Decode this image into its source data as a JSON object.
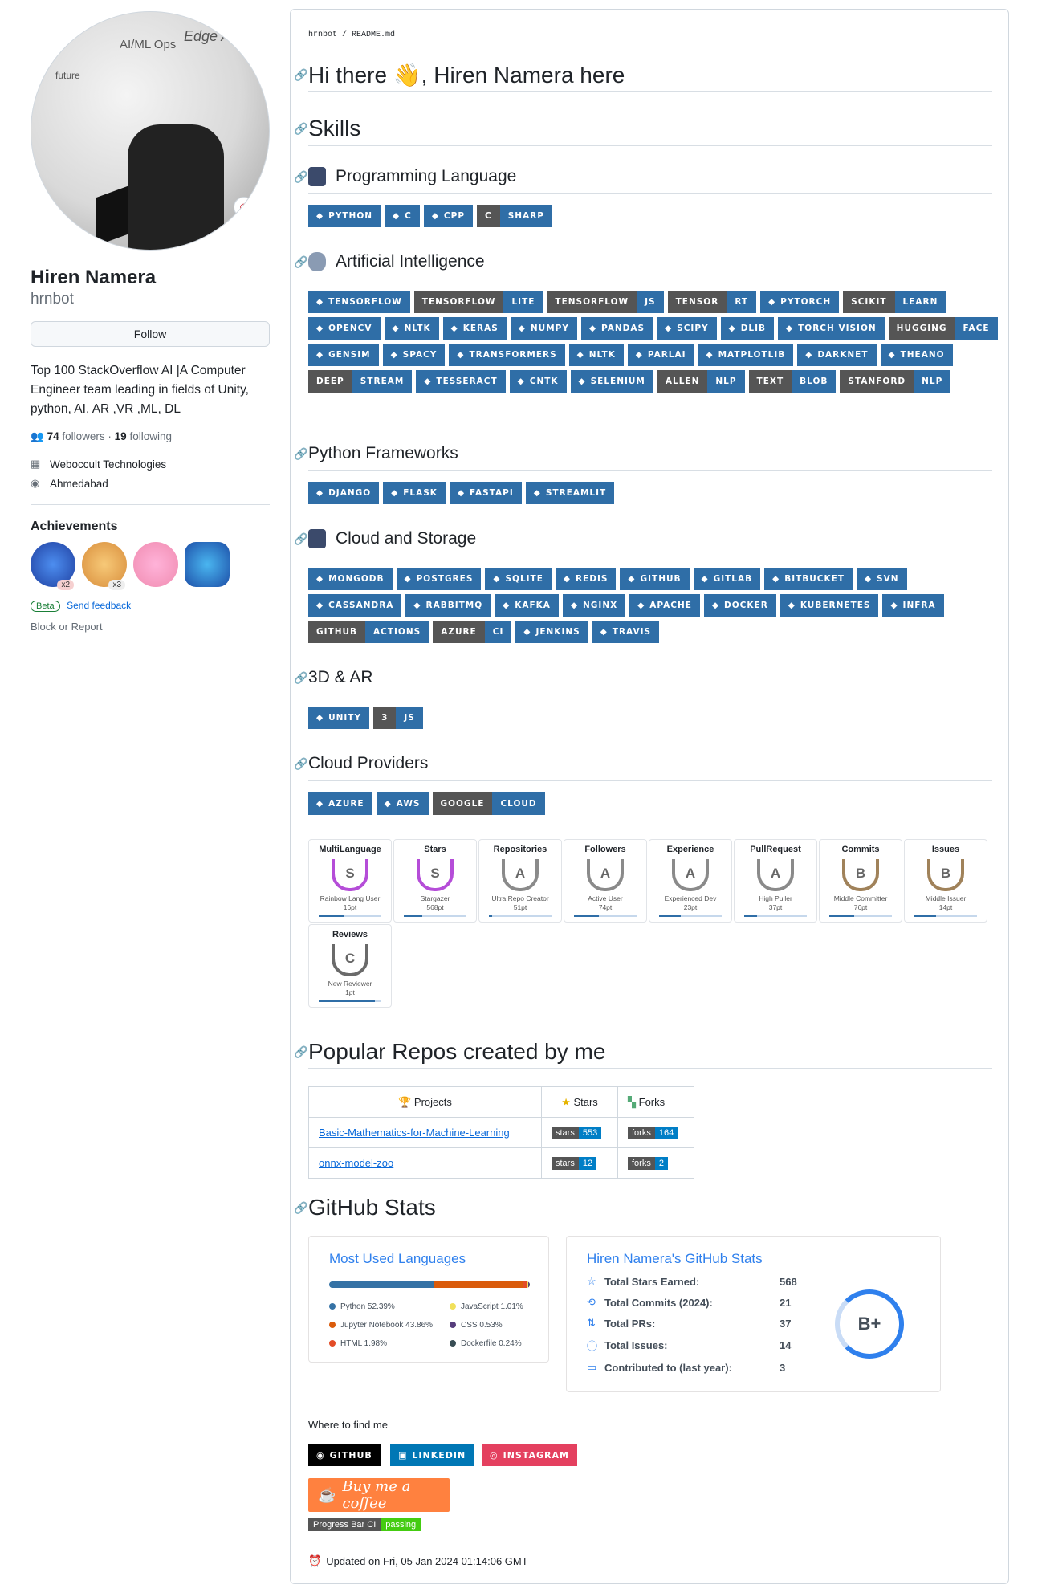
{
  "profile": {
    "name": "Hiren Namera",
    "login": "hrnbot",
    "follow": "Follow",
    "bio": "Top 100 StackOverflow AI |A Computer Engineer team leading in fields of Unity, python, AI, AR ,VR ,ML, DL",
    "followers_count": "74",
    "followers_label": "followers",
    "following_count": "19",
    "following_label": "following",
    "company": "Weboccult Technologies",
    "location": "Ahmedabad",
    "achievements_title": "Achievements",
    "ach_x2": "x2",
    "ach_x3": "x3",
    "beta": "Beta",
    "send_feedback": "Send feedback",
    "block": "Block or Report",
    "wall_texts": [
      "AI/ML Ops",
      "Edge AI",
      "e",
      "future"
    ]
  },
  "readme": {
    "crumb": "hrnbot / README.md",
    "h_hi": "Hi there 👋, Hiren Namera here",
    "h_skills": "Skills",
    "h_prog": "Programming Language",
    "h_ai": "Artificial Intelligence",
    "h_pyfw": "Python Frameworks",
    "h_cloud": "Cloud and Storage",
    "h_3d": "3D & AR",
    "h_providers": "Cloud Providers",
    "h_repos": "Popular Repos created by me",
    "h_stats": "GitHub Stats",
    "where": "Where to find me",
    "updated": "Updated on Fri, 05 Jan 2024 01:14:06 GMT"
  },
  "badges": {
    "prog": [
      [
        "",
        "PYTHON"
      ],
      [
        "",
        "C"
      ],
      [
        "",
        "CPP"
      ],
      [
        "C",
        "SHARP"
      ]
    ],
    "ai": [
      [
        "",
        "TENSORFLOW"
      ],
      [
        "TENSORFLOW",
        "LITE"
      ],
      [
        "TENSORFLOW",
        "JS"
      ],
      [
        "TENSOR",
        "RT"
      ],
      [
        "",
        "PYTORCH"
      ],
      [
        "SCIKIT",
        "LEARN"
      ],
      [
        "",
        "OPENCV"
      ],
      [
        "",
        "NLTK"
      ],
      [
        "",
        "KERAS"
      ],
      [
        "",
        "NUMPY"
      ],
      [
        "",
        "PANDAS"
      ],
      [
        "",
        "SCIPY"
      ],
      [
        "",
        "DLIB"
      ],
      [
        "",
        "TORCH VISION"
      ],
      [
        "HUGGING",
        "FACE"
      ],
      [
        "",
        "GENSIM"
      ],
      [
        "",
        "SPACY"
      ],
      [
        "",
        "TRANSFORMERS"
      ],
      [
        "",
        "NLTK"
      ],
      [
        "",
        "PARLAI"
      ],
      [
        "",
        "MATPLOTLIB"
      ],
      [
        "",
        "DARKNET"
      ],
      [
        "",
        "THEANO"
      ],
      [
        "DEEP",
        "STREAM"
      ],
      [
        "",
        "TESSERACT"
      ],
      [
        "",
        "CNTK"
      ],
      [
        "",
        "SELENIUM"
      ],
      [
        "ALLEN",
        "NLP"
      ],
      [
        "TEXT",
        "BLOB"
      ],
      [
        "STANFORD",
        "NLP"
      ]
    ],
    "pyfw": [
      [
        "",
        "DJANGO"
      ],
      [
        "",
        "FLASK"
      ],
      [
        "",
        "FASTAPI"
      ],
      [
        "",
        "STREAMLIT"
      ]
    ],
    "cloud": [
      [
        "",
        "MONGODB"
      ],
      [
        "",
        "POSTGRES"
      ],
      [
        "",
        "SQLITE"
      ],
      [
        "",
        "REDIS"
      ],
      [
        "",
        "GITHUB"
      ],
      [
        "",
        "GITLAB"
      ],
      [
        "",
        "BITBUCKET"
      ],
      [
        "",
        "SVN"
      ],
      [
        "",
        "CASSANDRA"
      ],
      [
        "",
        "RABBITMQ"
      ],
      [
        "",
        "KAFKA"
      ],
      [
        "",
        "NGINX"
      ],
      [
        "",
        "APACHE"
      ],
      [
        "",
        "DOCKER"
      ],
      [
        "",
        "KUBERNETES"
      ],
      [
        "",
        "INFRA"
      ],
      [
        "GITHUB",
        "ACTIONS"
      ],
      [
        "AZURE",
        "CI"
      ],
      [
        "",
        "JENKINS"
      ],
      [
        "",
        "TRAVIS"
      ]
    ],
    "ar": [
      [
        "",
        "UNITY"
      ],
      [
        "3",
        "JS"
      ]
    ],
    "providers": [
      [
        "",
        "AZURE"
      ],
      [
        "",
        "AWS"
      ],
      [
        "GOOGLE",
        "CLOUD"
      ]
    ]
  },
  "trophies": [
    {
      "title": "MultiLanguage",
      "rank": "S",
      "sub": "Rainbow Lang User",
      "pts": "16pt",
      "progress": 0.4
    },
    {
      "title": "Stars",
      "rank": "S",
      "sub": "Stargazer",
      "pts": "568pt",
      "progress": 0.3
    },
    {
      "title": "Repositories",
      "rank": "A",
      "sub": "Ultra Repo Creator",
      "pts": "51pt",
      "progress": 0.05
    },
    {
      "title": "Followers",
      "rank": "A",
      "sub": "Active User",
      "pts": "74pt",
      "progress": 0.4
    },
    {
      "title": "Experience",
      "rank": "A",
      "sub": "Experienced Dev",
      "pts": "23pt",
      "progress": 0.35
    },
    {
      "title": "PullRequest",
      "rank": "A",
      "sub": "High Puller",
      "pts": "37pt",
      "progress": 0.2
    },
    {
      "title": "Commits",
      "rank": "B",
      "sub": "Middle Committer",
      "pts": "76pt",
      "progress": 0.4
    },
    {
      "title": "Issues",
      "rank": "B",
      "sub": "Middle Issuer",
      "pts": "14pt",
      "progress": 0.35
    },
    {
      "title": "Reviews",
      "rank": "C",
      "sub": "New Reviewer",
      "pts": "1pt",
      "progress": 0.9
    }
  ],
  "repos": {
    "headers": [
      "Projects",
      "Stars",
      "Forks"
    ],
    "rows": [
      {
        "name": "Basic-Mathematics-for-Machine-Learning",
        "stars_l": "stars",
        "stars": "553",
        "forks_l": "forks",
        "forks": "164"
      },
      {
        "name": "onnx-model-zoo",
        "stars_l": "stars",
        "stars": "12",
        "forks_l": "forks",
        "forks": "2"
      }
    ]
  },
  "langs": {
    "title": "Most Used Languages",
    "items": [
      {
        "label": "Python 52.39%",
        "color": "#3572A5"
      },
      {
        "label": "JavaScript 1.01%",
        "color": "#f1e05a"
      },
      {
        "label": "Jupyter Notebook 43.86%",
        "color": "#DA5B0B"
      },
      {
        "label": "CSS 0.53%",
        "color": "#563d7c"
      },
      {
        "label": "HTML 1.98%",
        "color": "#e34c26"
      },
      {
        "label": "Dockerfile 0.24%",
        "color": "#384d54"
      }
    ]
  },
  "stats": {
    "title": "Hiren Namera's GitHub Stats",
    "rows": [
      {
        "k": "Total Stars Earned:",
        "v": "568",
        "icon": "☆"
      },
      {
        "k": "Total Commits (2024):",
        "v": "21",
        "icon": "⟲"
      },
      {
        "k": "Total PRs:",
        "v": "37",
        "icon": "⇅"
      },
      {
        "k": "Total Issues:",
        "v": "14",
        "icon": "ⓘ"
      },
      {
        "k": "Contributed to (last year):",
        "v": "3",
        "icon": "▭"
      }
    ],
    "grade": "B+"
  },
  "social": [
    {
      "label": "GITHUB",
      "color": "#000"
    },
    {
      "label": "LINKEDIN",
      "color": "#0077B5"
    },
    {
      "label": "INSTAGRAM",
      "color": "#E4405F"
    }
  ],
  "coffee": "Buy me a coffee",
  "ci": {
    "left": "Progress Bar CI",
    "right": "passing"
  }
}
